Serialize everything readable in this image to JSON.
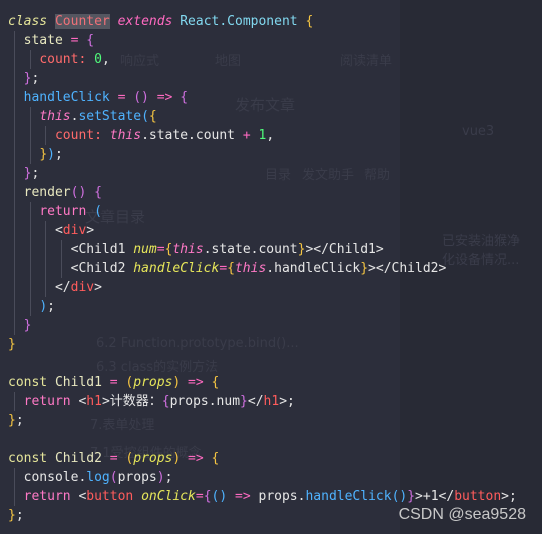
{
  "code_lines": [
    [
      [
        "kwi",
        "class"
      ],
      [
        "txt",
        " "
      ],
      [
        "cls",
        "Counter"
      ],
      [
        "txt",
        " "
      ],
      [
        "ext",
        "extends"
      ],
      [
        "txt",
        " "
      ],
      [
        "type",
        "React.Component"
      ],
      [
        "txt",
        " "
      ],
      [
        "b1",
        "{"
      ]
    ],
    [
      [
        "txt",
        "  "
      ],
      [
        "id",
        "state"
      ],
      [
        "txt",
        " "
      ],
      [
        "op",
        "="
      ],
      [
        "txt",
        " "
      ],
      [
        "b2",
        "{"
      ]
    ],
    [
      [
        "txt",
        "    "
      ],
      [
        "key",
        "count"
      ],
      [
        "key",
        ":"
      ],
      [
        "txt",
        " "
      ],
      [
        "num",
        "0"
      ],
      [
        "txt",
        ","
      ]
    ],
    [
      [
        "txt",
        "  "
      ],
      [
        "b2",
        "}"
      ],
      [
        "txt",
        ";"
      ]
    ],
    [
      [
        "txt",
        "  "
      ],
      [
        "fn",
        "handleClick"
      ],
      [
        "txt",
        " "
      ],
      [
        "op",
        "="
      ],
      [
        "txt",
        " "
      ],
      [
        "b2",
        "()"
      ],
      [
        "txt",
        " "
      ],
      [
        "op",
        "=>"
      ],
      [
        "txt",
        " "
      ],
      [
        "b2",
        "{"
      ]
    ],
    [
      [
        "txt",
        "    "
      ],
      [
        "this",
        "this"
      ],
      [
        "txt",
        "."
      ],
      [
        "fn",
        "setState"
      ],
      [
        "b3",
        "("
      ],
      [
        "b1",
        "{"
      ]
    ],
    [
      [
        "txt",
        "      "
      ],
      [
        "key",
        "count"
      ],
      [
        "key",
        ":"
      ],
      [
        "txt",
        " "
      ],
      [
        "this",
        "this"
      ],
      [
        "txt",
        ".state.count "
      ],
      [
        "op",
        "+"
      ],
      [
        "txt",
        " "
      ],
      [
        "num",
        "1"
      ],
      [
        "txt",
        ","
      ]
    ],
    [
      [
        "txt",
        "    "
      ],
      [
        "b1",
        "}"
      ],
      [
        "b3",
        ")"
      ],
      [
        "txt",
        ";"
      ]
    ],
    [
      [
        "txt",
        "  "
      ],
      [
        "b2",
        "}"
      ],
      [
        "txt",
        ";"
      ]
    ],
    [
      [
        "txt",
        "  "
      ],
      [
        "id",
        "render"
      ],
      [
        "b2",
        "()"
      ],
      [
        "txt",
        " "
      ],
      [
        "b2",
        "{"
      ]
    ],
    [
      [
        "txt",
        "    "
      ],
      [
        "ret",
        "return"
      ],
      [
        "txt",
        " "
      ],
      [
        "b3",
        "("
      ]
    ],
    [
      [
        "txt",
        "      <"
      ],
      [
        "tag",
        "div"
      ],
      [
        "txt",
        ">"
      ]
    ],
    [
      [
        "txt",
        "        <Child1 "
      ],
      [
        "attr",
        "num"
      ],
      [
        "op",
        "="
      ],
      [
        "b1",
        "{"
      ],
      [
        "this",
        "this"
      ],
      [
        "txt",
        ".state.count"
      ],
      [
        "b1",
        "}"
      ],
      [
        "txt",
        "></Child1>"
      ]
    ],
    [
      [
        "txt",
        "        <Child2 "
      ],
      [
        "attr",
        "handleClick"
      ],
      [
        "op",
        "="
      ],
      [
        "b1",
        "{"
      ],
      [
        "this",
        "this"
      ],
      [
        "txt",
        ".handleClick"
      ],
      [
        "b1",
        "}"
      ],
      [
        "txt",
        "></Child2>"
      ]
    ],
    [
      [
        "txt",
        "      </"
      ],
      [
        "tag",
        "div"
      ],
      [
        "txt",
        ">"
      ]
    ],
    [
      [
        "txt",
        "    "
      ],
      [
        "b3",
        ")"
      ],
      [
        "txt",
        ";"
      ]
    ],
    [
      [
        "txt",
        "  "
      ],
      [
        "b2",
        "}"
      ]
    ],
    [
      [
        "b1",
        "}"
      ]
    ],
    [],
    [
      [
        "kw",
        "const"
      ],
      [
        "txt",
        " "
      ],
      [
        "id",
        "Child1"
      ],
      [
        "txt",
        " "
      ],
      [
        "op",
        "="
      ],
      [
        "txt",
        " "
      ],
      [
        "b1",
        "("
      ],
      [
        "attr",
        "props"
      ],
      [
        "b1",
        ")"
      ],
      [
        "txt",
        " "
      ],
      [
        "op",
        "=>"
      ],
      [
        "txt",
        " "
      ],
      [
        "b1",
        "{"
      ]
    ],
    [
      [
        "txt",
        "  "
      ],
      [
        "ret",
        "return"
      ],
      [
        "txt",
        " <"
      ],
      [
        "tag",
        "h1"
      ],
      [
        "txt",
        ">计数器："
      ],
      [
        "b2",
        "{"
      ],
      [
        "txt",
        "props.num"
      ],
      [
        "b2",
        "}"
      ],
      [
        "txt",
        "</"
      ],
      [
        "tag",
        "h1"
      ],
      [
        "txt",
        ">;"
      ]
    ],
    [
      [
        "b1",
        "}"
      ],
      [
        "txt",
        ";"
      ]
    ],
    [],
    [
      [
        "kw",
        "const"
      ],
      [
        "txt",
        " "
      ],
      [
        "id",
        "Child2"
      ],
      [
        "txt",
        " "
      ],
      [
        "op",
        "="
      ],
      [
        "txt",
        " "
      ],
      [
        "b1",
        "("
      ],
      [
        "attr",
        "props"
      ],
      [
        "b1",
        ")"
      ],
      [
        "txt",
        " "
      ],
      [
        "op",
        "=>"
      ],
      [
        "txt",
        " "
      ],
      [
        "b1",
        "{"
      ]
    ],
    [
      [
        "txt",
        "  console."
      ],
      [
        "fn",
        "log"
      ],
      [
        "b2",
        "("
      ],
      [
        "txt",
        "props"
      ],
      [
        "b2",
        ")"
      ],
      [
        "txt",
        ";"
      ]
    ],
    [
      [
        "txt",
        "  "
      ],
      [
        "ret",
        "return"
      ],
      [
        "txt",
        " <"
      ],
      [
        "tag",
        "button"
      ],
      [
        "txt",
        " "
      ],
      [
        "attr",
        "onClick"
      ],
      [
        "op",
        "="
      ],
      [
        "b2",
        "{"
      ],
      [
        "b3",
        "()"
      ],
      [
        "txt",
        " "
      ],
      [
        "op",
        "=>"
      ],
      [
        "txt",
        " props."
      ],
      [
        "fn",
        "handleClick"
      ],
      [
        "b3",
        "()"
      ],
      [
        "b2",
        "}"
      ],
      [
        "txt",
        ">+1</"
      ],
      [
        "tag",
        "button"
      ],
      [
        "txt",
        ">;"
      ]
    ],
    [
      [
        "b1",
        "}"
      ],
      [
        "txt",
        ";"
      ]
    ]
  ],
  "background_ghost": {
    "nav": [
      "项目",
      "响应式",
      "地图",
      "阅读清单"
    ],
    "publish": "发布文章",
    "tools": [
      "目录",
      "发文助手",
      "帮助"
    ],
    "toc_title": "文章目录",
    "toc_items": [
      "6.2 Function.prototype.bind()...",
      "6.3 class的实例方法",
      "7.表单处理",
      "7.1受控组件的概念"
    ],
    "side_items": [
      "vue3",
      "已安装油猴净化设备情况..."
    ]
  },
  "watermark": "CSDN @sea9528"
}
